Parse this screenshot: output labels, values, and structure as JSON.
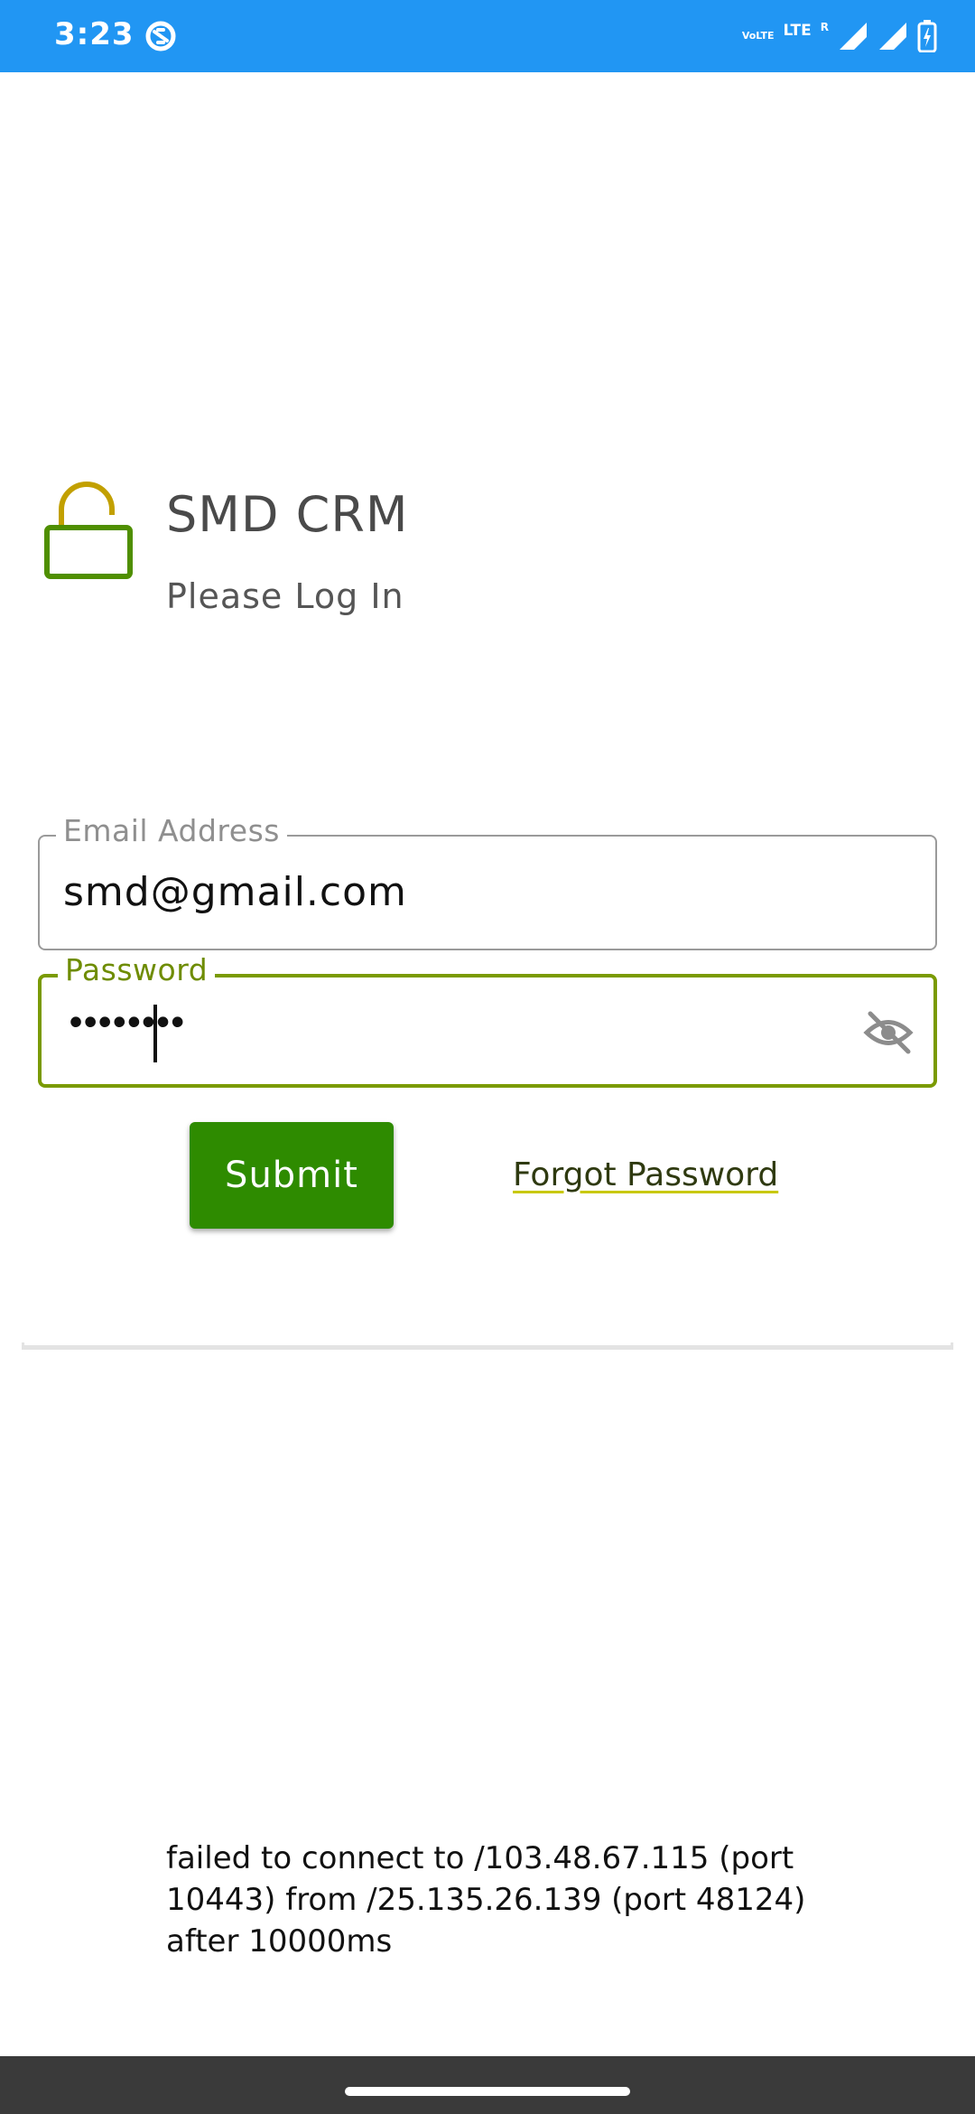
{
  "status_bar": {
    "time": "3:23",
    "volte_top": "VoLTE",
    "lte": "LTE",
    "roam": "R"
  },
  "header": {
    "title": "SMD CRM",
    "subtitle": "Please Log In"
  },
  "form": {
    "email_label": "Email Address",
    "email_value": "smd@gmail.com",
    "password_label": "Password",
    "password_value": "••••••••",
    "submit_label": "Submit",
    "forgot_label": "Forgot Password"
  },
  "error": {
    "message": "failed to connect to /103.48.67.115 (port 10443) from /25.135.26.139 (port 48124) after 10000ms"
  },
  "colors": {
    "status_bar": "#2196f3",
    "accent": "#7a9a00",
    "submit_button": "#2e8b00",
    "nav_bar": "#3a3a3a"
  },
  "icons": {
    "lock": "lock-open-icon",
    "visibility": "visibility-off-icon",
    "status_app": "status-app-icon",
    "signal": "signal-icon",
    "battery": "battery-icon"
  }
}
